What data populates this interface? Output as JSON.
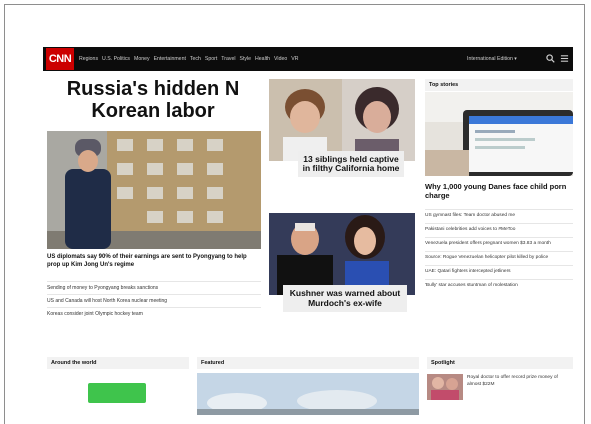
{
  "header": {
    "logo": "CNN",
    "nav_items": [
      "Regions",
      "U.S. Politics",
      "Money",
      "Entertainment",
      "Tech",
      "Sport",
      "Travel",
      "Style",
      "Health",
      "Video",
      "VR"
    ],
    "edition": "International Edition ▾",
    "search_icon": "search-icon",
    "menu_icon": "menu-icon"
  },
  "lead": {
    "headline": "Russia's hidden N Korean labor",
    "caption": "US diplomats say 90% of their earnings are sent to Pyongyang to help prop up Kim Jong Un's regime",
    "links": [
      "Sending of money to Pyongyang breaks sanctions",
      "US and Canada will host North Korea nuclear meeting",
      "Koreas consider joint Olympic hockey team"
    ]
  },
  "middle": {
    "story1": "13 siblings held captive in filthy California home",
    "story2": "Kushner was warned about Murdoch's ex-wife"
  },
  "top_stories": {
    "label": "Top stories",
    "headline": "Why 1,000 young Danes face child porn charge",
    "links": [
      "US gymnast files: Team doctor abused me",
      "Pakistani celebrities add voices to #MeToo",
      "Venezuela president offers pregnant women $3.83 a month",
      "Source: Rogue Venezuelan helicopter pilot killed by police",
      "UAE: Qatari fighters intercepted jetliners",
      "'Bully' star accuses stuntman of molestation"
    ]
  },
  "sections": {
    "around": "Around the world",
    "featured": "Featured",
    "spotlight": "Spotlight",
    "spotlight_text": "Royal doctor to offer record prize money of almost $22M"
  }
}
